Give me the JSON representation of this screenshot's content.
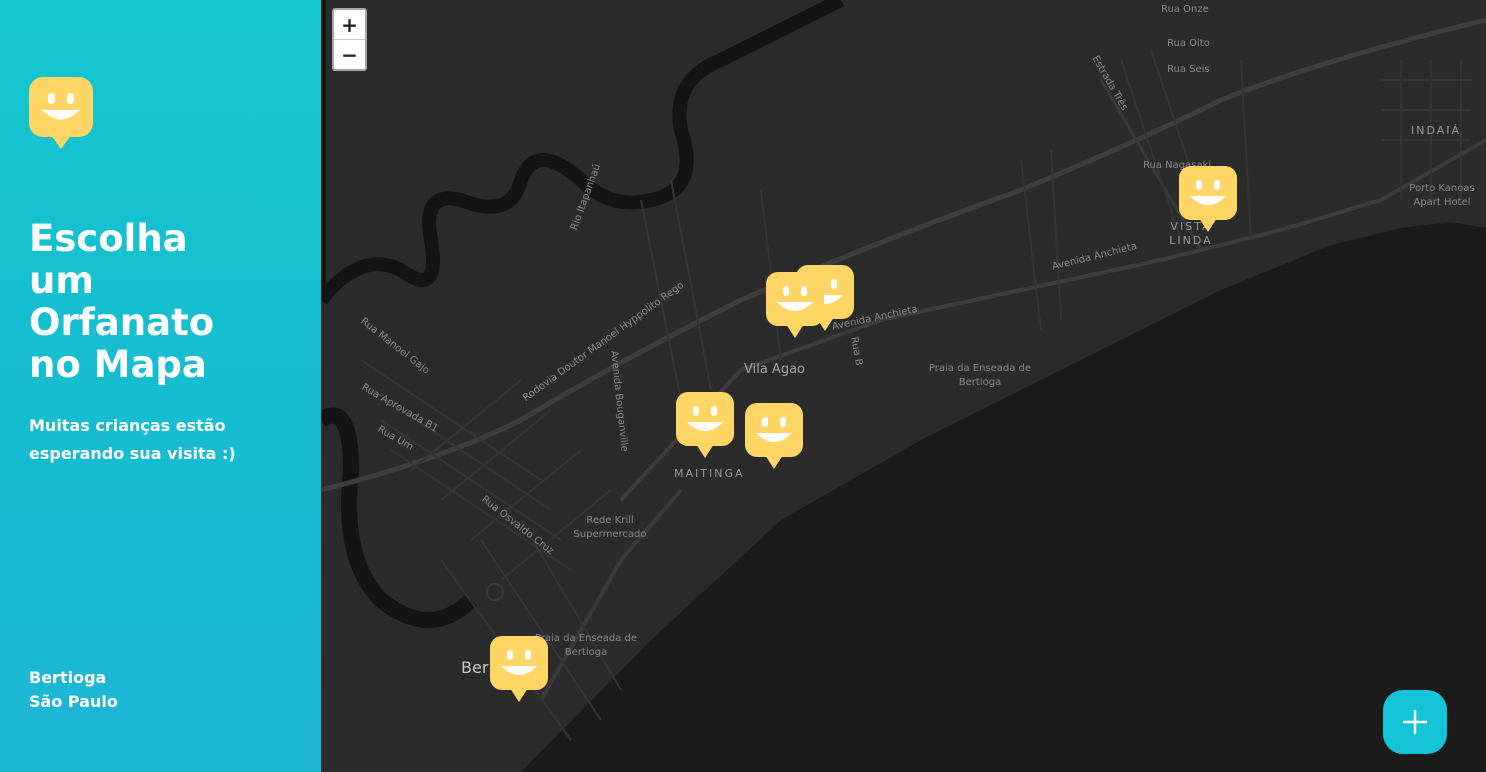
{
  "sidebar": {
    "title": "Escolha um Orfanato no Mapa",
    "subtitle": "Muitas crianças estão esperando sua visita :)",
    "city": "Bertioga",
    "state": "São Paulo"
  },
  "map": {
    "zoom_in": "+",
    "zoom_out": "−",
    "labels": {
      "rua_onze": "Rua Onze",
      "rua_oito": "Rua Oito",
      "rua_seis": "Rua Seis",
      "estrada_tres": "Estrada Três",
      "indaia": "INDAIÁ",
      "rua_nagasaki": "Rua Nagasaki",
      "porto_kanoas": "Porto Kanoas Apart Hotel",
      "vista_linda": "VISTA LINDA",
      "avenida_anchieta_1": "Avenida Anchieta",
      "avenida_anchieta_2": "Avenida Anchieta",
      "rodovia": "Rodovia Doutor Manoel Hyppolito Rego",
      "rio_itapanhau": "Rio Itapanhaú",
      "rua_manoel_gajo": "Rua Manoel Gajo",
      "rua_aprovada": "Rua Aprovada B1",
      "rua_um": "Rua Um",
      "rua_b": "Rua B",
      "vila_agao": "Vila Agao",
      "avenida_bouganville": "Avenida Bouganville",
      "praia_enseada_1": "Praia da Enseada de Bertioga",
      "praia_enseada_2": "Praia da Enseada de Bertioga",
      "maitinga": "MAITINGA",
      "rua_osvaldo_cruz": "Rua Osvaldo Cruz",
      "rede_krill": "Rede Krill Supermercado",
      "bertioga": "Ber"
    }
  },
  "colors": {
    "sidebar_accent": "#15c3d6",
    "marker": "#ffd666",
    "map_land": "#2b2b2b",
    "map_water": "#1a1a1a"
  },
  "icons": {
    "logo": "smiley-pin-icon",
    "marker": "smiley-pin-icon",
    "add": "plus-icon"
  }
}
